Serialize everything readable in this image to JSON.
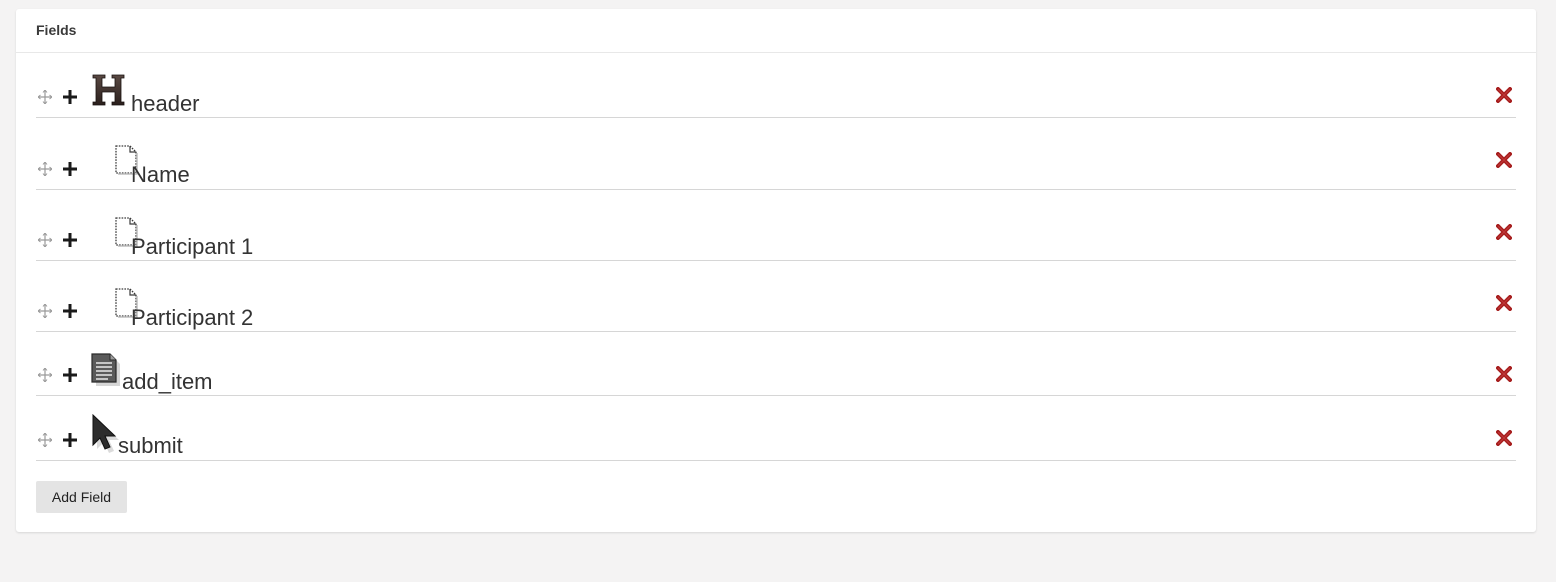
{
  "panel": {
    "title": "Fields"
  },
  "fields": [
    {
      "label": "header",
      "type_icon": "heading-icon"
    },
    {
      "label": "Name",
      "type_icon": "text-field-icon"
    },
    {
      "label": "Participant 1",
      "type_icon": "text-field-icon"
    },
    {
      "label": "Participant 2",
      "type_icon": "text-field-icon"
    },
    {
      "label": "add_item",
      "type_icon": "document-lines-icon"
    },
    {
      "label": "submit",
      "type_icon": "cursor-arrow-icon"
    }
  ],
  "actions": {
    "add_field_label": "Add Field"
  },
  "colors": {
    "delete": "#a61d1d",
    "text": "#333333",
    "page_background": "#f4f3f3"
  }
}
